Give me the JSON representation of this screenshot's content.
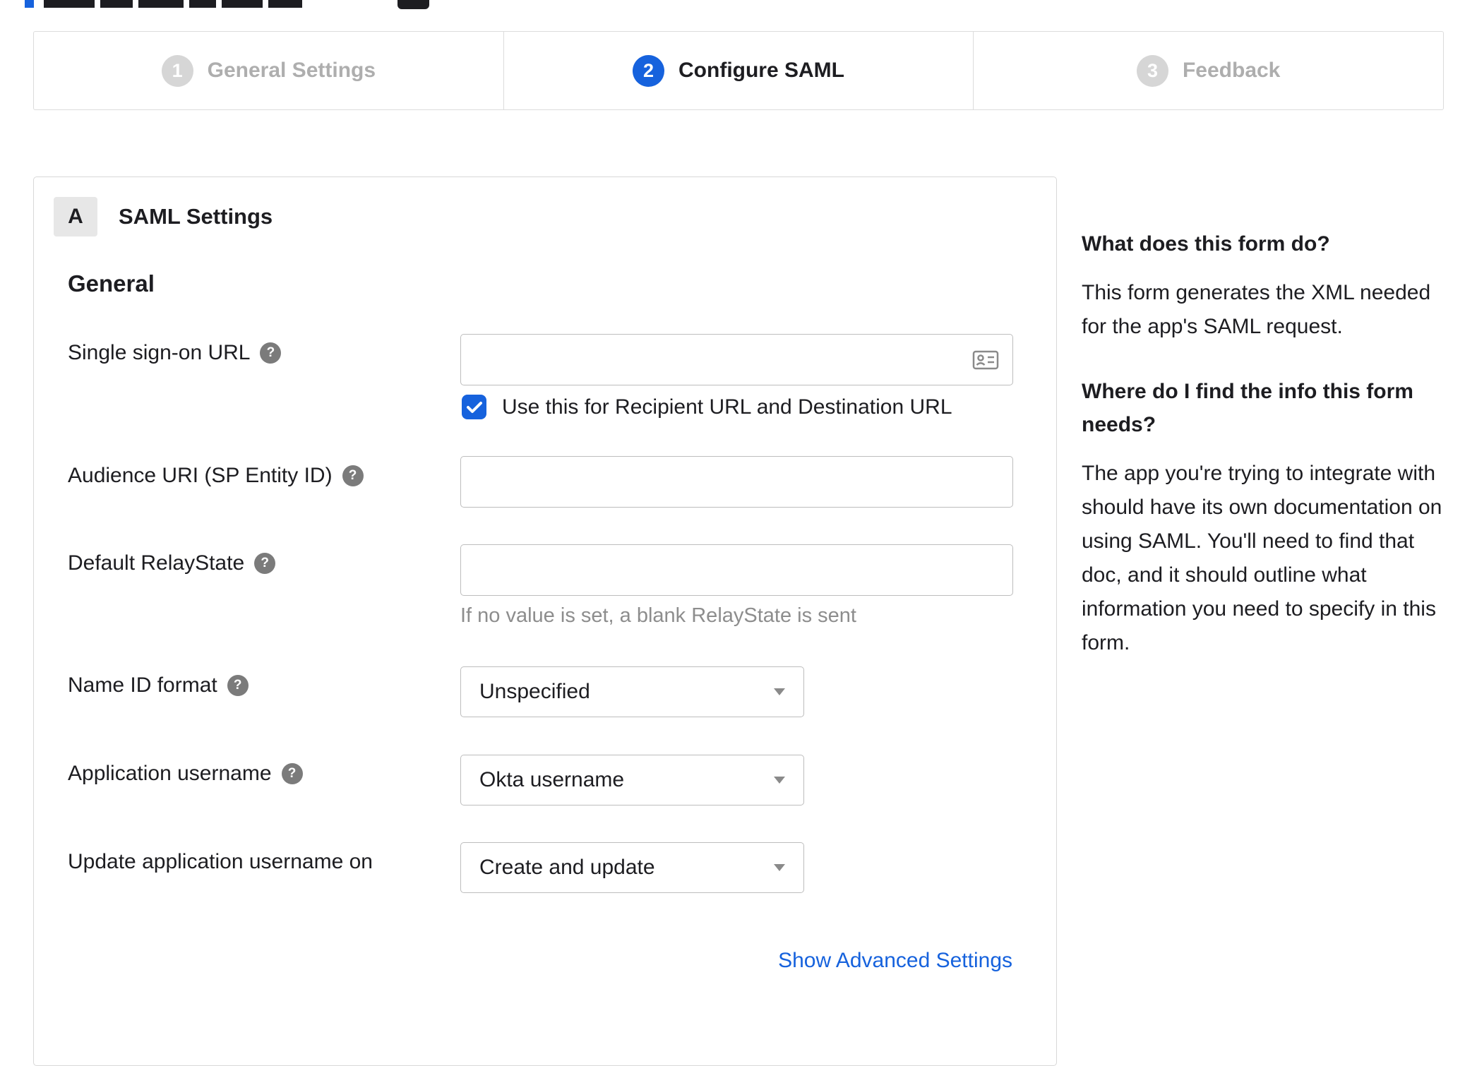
{
  "stepper": {
    "steps": [
      {
        "number": "1",
        "label": "General Settings",
        "state": "inactive"
      },
      {
        "number": "2",
        "label": "Configure SAML",
        "state": "active"
      },
      {
        "number": "3",
        "label": "Feedback",
        "state": "inactive"
      }
    ]
  },
  "panel": {
    "section_badge": "A",
    "section_title": "SAML Settings",
    "group_title": "General",
    "fields": {
      "sso": {
        "label": "Single sign-on URL",
        "value": "",
        "checkbox_label": "Use this for Recipient URL and Destination URL",
        "checkbox_checked": true
      },
      "audience": {
        "label": "Audience URI (SP Entity ID)",
        "value": ""
      },
      "relay": {
        "label": "Default RelayState",
        "value": "",
        "helper": "If no value is set, a blank RelayState is sent"
      },
      "nameid": {
        "label": "Name ID format",
        "value": "Unspecified"
      },
      "appuser": {
        "label": "Application username",
        "value": "Okta username"
      },
      "update": {
        "label": "Update application username on",
        "value": "Create and update"
      }
    },
    "advanced_link": "Show Advanced Settings"
  },
  "sidebar": {
    "q1": "What does this form do?",
    "a1": "This form generates the XML needed for the app's SAML request.",
    "q2": "Where do I find the info this form needs?",
    "a2": "The app you're trying to integrate with should have its own documentation on using SAML. You'll need to find that doc, and it should outline what information you need to specify in this form."
  },
  "colors": {
    "accent": "#1662dd",
    "inactive_circle": "#d6d6d6",
    "inactive_text": "#aeaeae",
    "text": "#1d1d21",
    "muted": "#8d8d8d",
    "border": "#bdbdbd",
    "link": "#1662dd"
  }
}
